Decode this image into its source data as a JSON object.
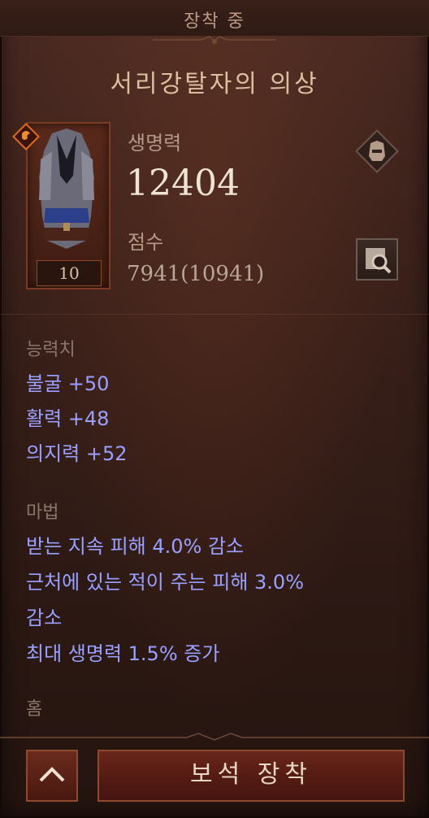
{
  "header": {
    "title": "장착 중"
  },
  "item": {
    "name": "서리강탈자의 의상",
    "level": "10",
    "icons": {
      "rarity": "rare-emblem-icon",
      "slot": "chest-armor-icon",
      "inspect": "magnifier-icon"
    }
  },
  "stats": {
    "life_label": "생명력",
    "life_value": "12404",
    "score_label": "점수",
    "score_value": "7941(10941)"
  },
  "attributes": {
    "title": "능력치",
    "items": [
      "불굴 +50",
      "활력 +48",
      "의지력 +52"
    ]
  },
  "magic": {
    "title": "마법",
    "lines": [
      "받는 지속 피해 4.0% 감소",
      "근처에 있는 적이 주는 피해 3.0%",
      "감소",
      "최대 생명력 1.5% 증가"
    ]
  },
  "sockets": {
    "title": "홈"
  },
  "footer": {
    "collapse_icon": "chevron-up-icon",
    "gem_button": "보석 장착"
  },
  "colors": {
    "affix": "#9aa0ff",
    "accent": "#8e4a30",
    "title": "#dcbfa0"
  }
}
